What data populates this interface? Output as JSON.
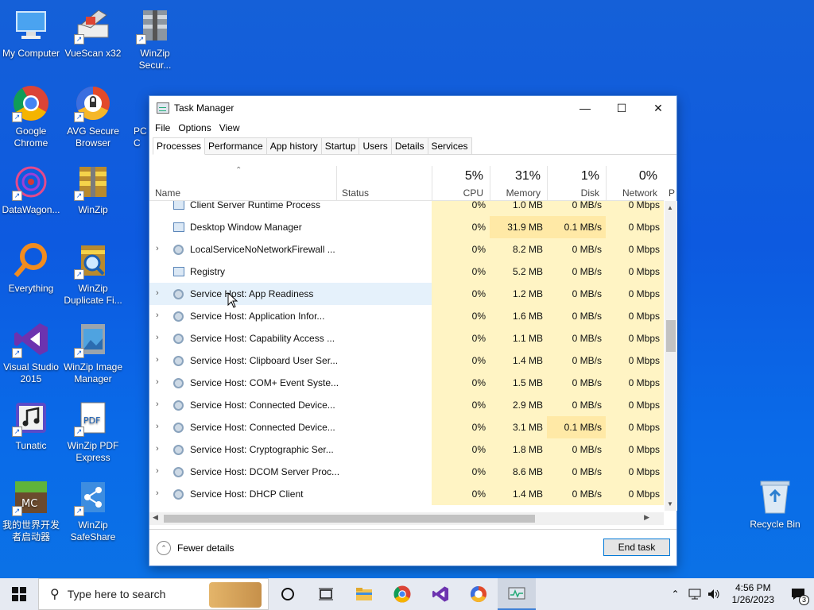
{
  "desktop": {
    "icons": [
      {
        "label": "My Computer"
      },
      {
        "label": "VueScan x32"
      },
      {
        "label": "WinZip Secur..."
      },
      {
        "label": "Google Chrome"
      },
      {
        "label": "AVG Secure Browser"
      },
      {
        "label": "PC C"
      },
      {
        "label": "DataWagon..."
      },
      {
        "label": "WinZip"
      },
      {
        "label": "Everything"
      },
      {
        "label": "WinZip Duplicate Fi..."
      },
      {
        "label": "Visual Studio 2015"
      },
      {
        "label": "WinZip Image Manager"
      },
      {
        "label": "Tunatic"
      },
      {
        "label": "WinZip PDF Express"
      },
      {
        "label": "我的世界开发者启动器"
      },
      {
        "label": "WinZip SafeShare"
      },
      {
        "label": "Recycle Bin"
      }
    ]
  },
  "taskmanager": {
    "title": "Task Manager",
    "menu": [
      "File",
      "Options",
      "View"
    ],
    "tabs": [
      "Processes",
      "Performance",
      "App history",
      "Startup",
      "Users",
      "Details",
      "Services"
    ],
    "active_tab": "Processes",
    "columns": {
      "name": "Name",
      "status": "Status",
      "cpu": {
        "pct": "5%",
        "label": "CPU"
      },
      "memory": {
        "pct": "31%",
        "label": "Memory"
      },
      "disk": {
        "pct": "1%",
        "label": "Disk"
      },
      "network": {
        "pct": "0%",
        "label": "Network"
      },
      "power": "P"
    },
    "rows": [
      {
        "name": "Client Server Runtime Process",
        "cpu": "0%",
        "mem": "1.0 MB",
        "disk": "0 MB/s",
        "net": "0 Mbps",
        "expand": false,
        "icon": "window"
      },
      {
        "name": "Desktop Window Manager",
        "cpu": "0%",
        "mem": "31.9 MB",
        "disk": "0.1 MB/s",
        "net": "0 Mbps",
        "expand": false,
        "icon": "window"
      },
      {
        "name": "LocalServiceNoNetworkFirewall ...",
        "cpu": "0%",
        "mem": "8.2 MB",
        "disk": "0 MB/s",
        "net": "0 Mbps",
        "expand": true,
        "icon": "gear"
      },
      {
        "name": "Registry",
        "cpu": "0%",
        "mem": "5.2 MB",
        "disk": "0 MB/s",
        "net": "0 Mbps",
        "expand": false,
        "icon": "window"
      },
      {
        "name": "Service Host: App Readiness",
        "cpu": "0%",
        "mem": "1.2 MB",
        "disk": "0 MB/s",
        "net": "0 Mbps",
        "expand": true,
        "icon": "gear"
      },
      {
        "name": "Service Host: Application Infor...",
        "cpu": "0%",
        "mem": "1.6 MB",
        "disk": "0 MB/s",
        "net": "0 Mbps",
        "expand": true,
        "icon": "gear"
      },
      {
        "name": "Service Host: Capability Access ...",
        "cpu": "0%",
        "mem": "1.1 MB",
        "disk": "0 MB/s",
        "net": "0 Mbps",
        "expand": true,
        "icon": "gear"
      },
      {
        "name": "Service Host: Clipboard User Ser...",
        "cpu": "0%",
        "mem": "1.4 MB",
        "disk": "0 MB/s",
        "net": "0 Mbps",
        "expand": true,
        "icon": "gear"
      },
      {
        "name": "Service Host: COM+ Event Syste...",
        "cpu": "0%",
        "mem": "1.5 MB",
        "disk": "0 MB/s",
        "net": "0 Mbps",
        "expand": true,
        "icon": "gear"
      },
      {
        "name": "Service Host: Connected Device...",
        "cpu": "0%",
        "mem": "2.9 MB",
        "disk": "0 MB/s",
        "net": "0 Mbps",
        "expand": true,
        "icon": "gear"
      },
      {
        "name": "Service Host: Connected Device...",
        "cpu": "0%",
        "mem": "3.1 MB",
        "disk": "0.1 MB/s",
        "net": "0 Mbps",
        "expand": true,
        "icon": "gear"
      },
      {
        "name": "Service Host: Cryptographic Ser...",
        "cpu": "0%",
        "mem": "1.8 MB",
        "disk": "0 MB/s",
        "net": "0 Mbps",
        "expand": true,
        "icon": "gear"
      },
      {
        "name": "Service Host: DCOM Server Proc...",
        "cpu": "0%",
        "mem": "8.6 MB",
        "disk": "0 MB/s",
        "net": "0 Mbps",
        "expand": true,
        "icon": "gear"
      },
      {
        "name": "Service Host: DHCP Client",
        "cpu": "0%",
        "mem": "1.4 MB",
        "disk": "0 MB/s",
        "net": "0 Mbps",
        "expand": true,
        "icon": "gear"
      }
    ],
    "fewer_details": "Fewer details",
    "end_task": "End task"
  },
  "taskbar": {
    "search_placeholder": "Type here to search",
    "time": "4:56 PM",
    "date": "1/26/2023",
    "notifications": "3"
  }
}
